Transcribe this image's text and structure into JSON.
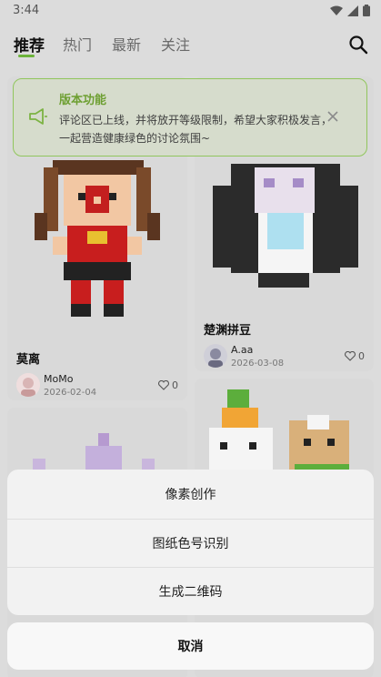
{
  "status_bar": {
    "time": "3:44"
  },
  "tabs": [
    {
      "label": "推荐",
      "active": true
    },
    {
      "label": "热门",
      "active": false
    },
    {
      "label": "最新",
      "active": false
    },
    {
      "label": "关注",
      "active": false
    }
  ],
  "accent_color": "#6bb33a",
  "notice": {
    "title": "版本功能",
    "body": "评论区已上线，并将放开等级限制，希望大家积极发言，一起营造健康绿色的讨论氛围~",
    "icon": "megaphone-icon"
  },
  "posts": [
    {
      "title": "莫离",
      "author": "MoMo",
      "date": "2026-02-04",
      "likes": "0"
    },
    {
      "title": "楚渊拼豆",
      "author": "A.aa",
      "date": "2026-03-08",
      "likes": "0"
    }
  ],
  "action_sheet": {
    "items": [
      "像素创作",
      "图纸色号识别",
      "生成二维码"
    ],
    "cancel": "取消"
  }
}
